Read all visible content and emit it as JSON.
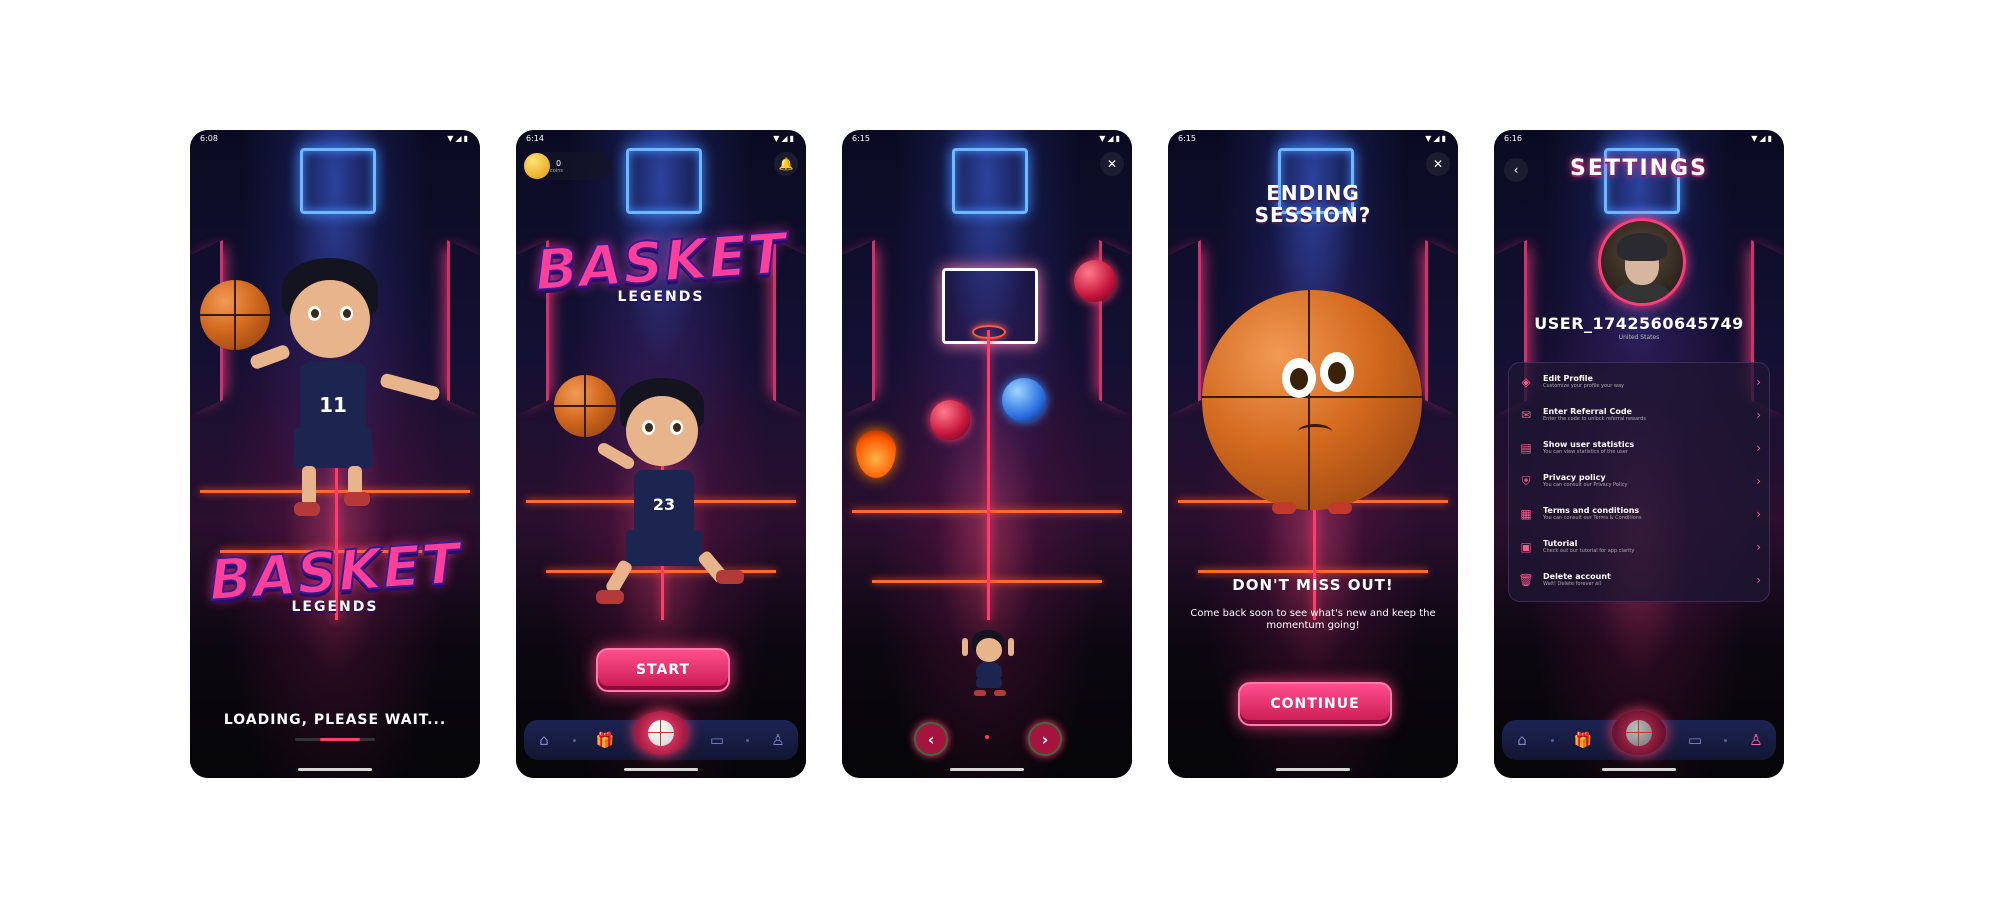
{
  "screens": [
    {
      "status_time": "6:08",
      "logo_big": "BASKET",
      "logo_small": "LEGENDS",
      "jersey_text": "11",
      "loading_text": "LOADING, PLEASE WAIT...",
      "loading_progress": 0.5
    },
    {
      "status_time": "6:14",
      "coin_count": "0",
      "coin_label": "coins",
      "bell_icon": "bell-icon",
      "logo_big": "BASKET",
      "logo_small": "LEGENDS",
      "start_label": "START"
    },
    {
      "status_time": "6:15",
      "close_icon": "close-icon",
      "prev_icon": "chevron-left-icon",
      "next_icon": "chevron-right-icon"
    },
    {
      "status_time": "6:15",
      "close_icon": "close-icon",
      "title_line1": "ENDING",
      "title_line2": "SESSION?",
      "subtitle": "DON'T MISS OUT!",
      "message": "Come back soon to see what's new and keep the momentum going!",
      "continue_label": "CONTINUE"
    },
    {
      "status_time": "6:16",
      "back_icon": "back-icon",
      "title": "SETTINGS",
      "username": "USER_1742560645749",
      "user_sub": "United States",
      "menu": [
        {
          "icon": "profile-icon",
          "glyph": "◈",
          "title": "Edit Profile",
          "desc": "Customize your profile your way"
        },
        {
          "icon": "gift-icon",
          "glyph": "✉",
          "title": "Enter Referral Code",
          "desc": "Enter the code to unlock referral rewards"
        },
        {
          "icon": "stats-icon",
          "glyph": "▤",
          "title": "Show user statistics",
          "desc": "You can view statistics of the user"
        },
        {
          "icon": "privacy-icon",
          "glyph": "⛨",
          "title": "Privacy policy",
          "desc": "You can consult our Privacy Policy"
        },
        {
          "icon": "terms-icon",
          "glyph": "▦",
          "title": "Terms and conditions",
          "desc": "You can consult our Terms & Conditions"
        },
        {
          "icon": "tutorial-icon",
          "glyph": "▣",
          "title": "Tutorial",
          "desc": "Check out our tutorial for app clarity"
        },
        {
          "icon": "trash-icon",
          "glyph": "🗑",
          "title": "Delete account",
          "desc": "Wait! Delete forever all"
        }
      ]
    }
  ],
  "nav_icons": [
    "home-icon",
    "gift-icon",
    "play-ball-icon",
    "ticket-icon",
    "profile-icon"
  ],
  "colors": {
    "accent": "#ff3c6a",
    "neon_blue": "#3f8cff",
    "court_orange": "#ff6a2e",
    "nav_bg": "#1d2352"
  }
}
